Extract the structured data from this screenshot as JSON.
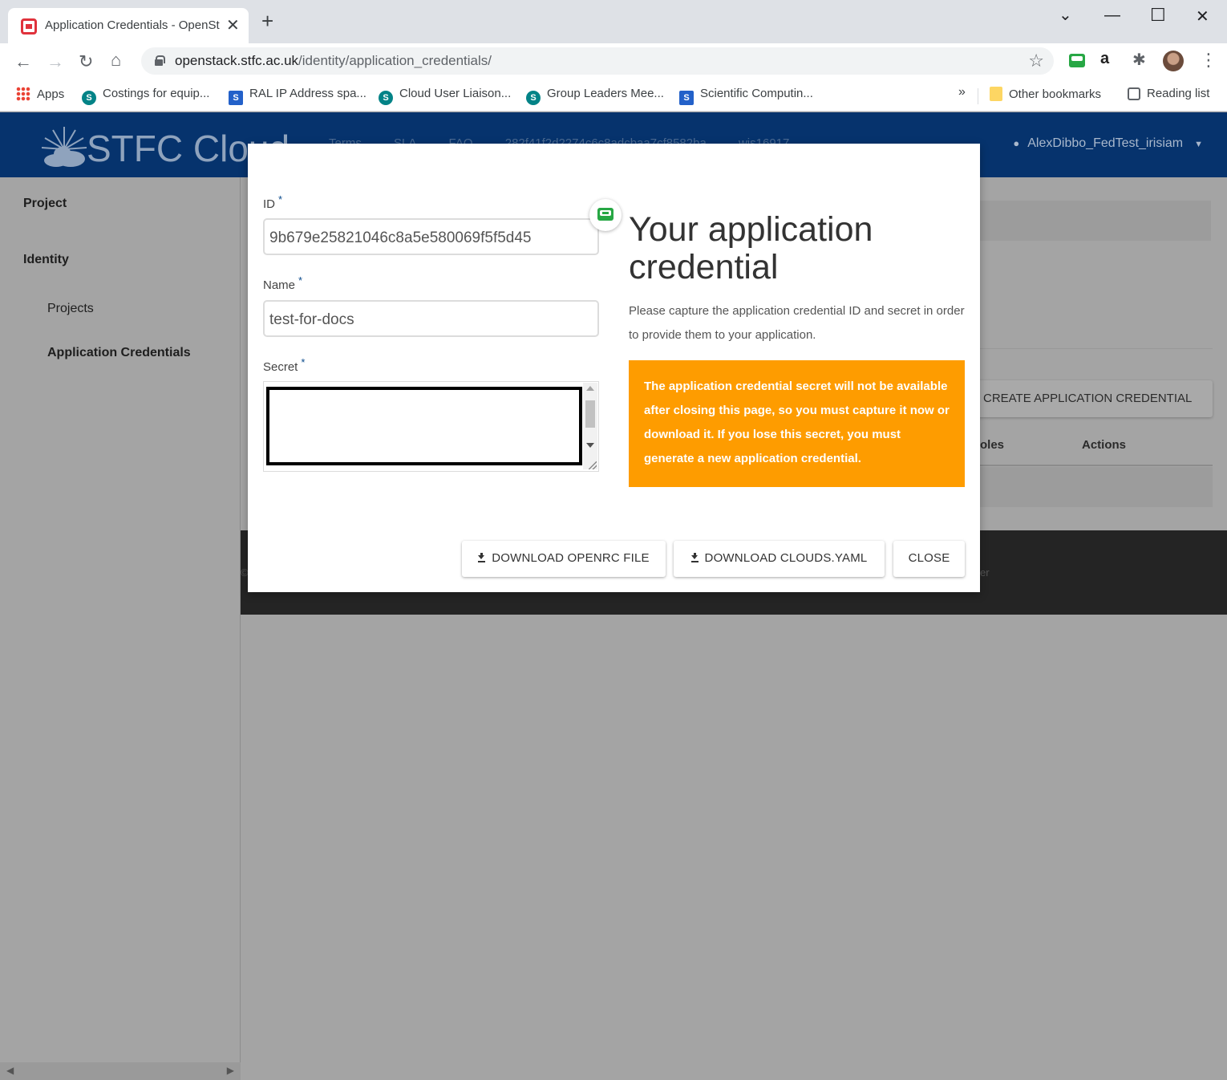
{
  "browser": {
    "tab_title": "Application Credentials - OpenSt",
    "url_host": "openstack.stfc.ac.uk",
    "url_path": "/identity/application_credentials/",
    "bookmarks": [
      {
        "label": "Apps",
        "icon": "apps-icon"
      },
      {
        "label": "Costings for equip...",
        "icon": "sharepoint-icon"
      },
      {
        "label": "RAL IP Address spa...",
        "icon": "sharepoint-icon"
      },
      {
        "label": "Cloud User Liaison...",
        "icon": "sharepoint-icon"
      },
      {
        "label": "Group Leaders Mee...",
        "icon": "sharepoint-icon"
      },
      {
        "label": "Scientific Computin...",
        "icon": "sharepoint-icon"
      }
    ],
    "overflow_label": "»",
    "other_bookmarks": "Other bookmarks",
    "reading_list": "Reading list"
  },
  "header": {
    "brand": "STFC Cloud",
    "links": [
      "Terms",
      "SLA",
      "FAQ"
    ],
    "project_id": "282f41f2d2274c6c8adcbaa7cf8582ba",
    "project_name": "wis16917",
    "user": "AlexDibbo_FedTest_irisiam"
  },
  "sidebar": {
    "items": [
      {
        "label": "Project"
      },
      {
        "label": "Identity"
      },
      {
        "label": "Projects"
      },
      {
        "label": "Application Credentials"
      }
    ]
  },
  "background": {
    "create_button": "CREATE APPLICATION CREDENTIAL",
    "col_roles": "oles",
    "col_actions": "Actions",
    "footer_left": "©",
    "footer_right": "er"
  },
  "modal": {
    "id_label": "ID",
    "id_value": "9b679e25821046c8a5e580069f5f5d45",
    "name_label": "Name",
    "name_value": "test-for-docs",
    "secret_label": "Secret",
    "required_mark": "*",
    "title": "Your application credential",
    "description": "Please capture the application credential ID and secret in order to provide them to your application.",
    "warning": "The application credential secret will not be available after closing this page, so you must capture it now or download it. If you lose this secret, you must generate a new application credential.",
    "buttons": {
      "download_openrc": "DOWNLOAD OPENRC FILE",
      "download_clouds": "DOWNLOAD CLOUDS.YAML",
      "close": "CLOSE"
    },
    "warning_color": "#fe9c00"
  }
}
